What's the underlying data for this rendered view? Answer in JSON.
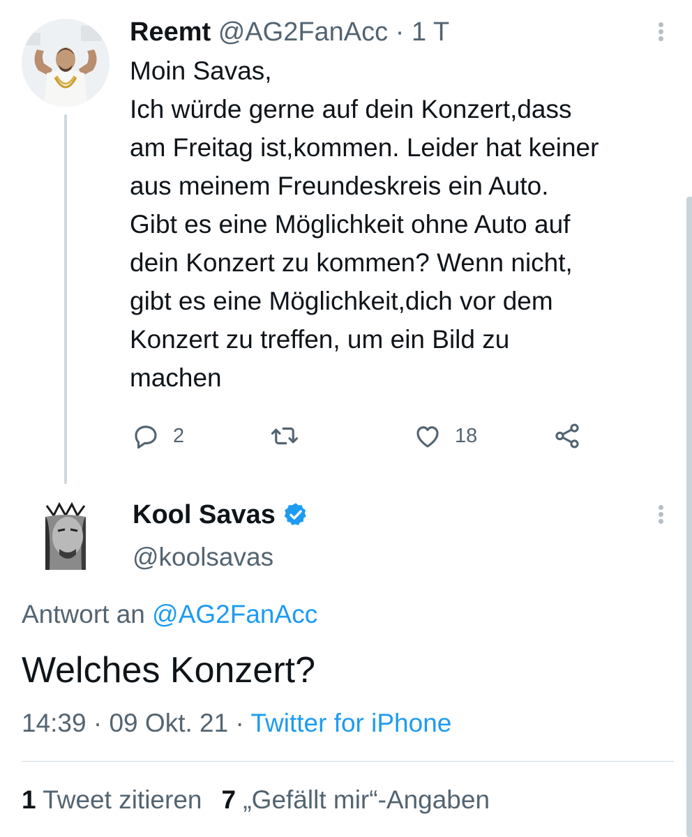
{
  "parent_tweet": {
    "author_name": "Reemt",
    "author_handle": "@AG2FanAcc",
    "separator": "·",
    "time_ago": "1 T",
    "text_lines": [
      "Moin Savas,",
      "Ich würde gerne auf dein Konzert,dass",
      "am Freitag ist,kommen. Leider hat keiner",
      "aus meinem Freundeskreis ein Auto.",
      "Gibt es eine Möglichkeit ohne Auto auf",
      "dein Konzert zu kommen? Wenn nicht,",
      "gibt es eine Möglichkeit,dich vor dem",
      "Konzert zu treffen, um ein Bild zu",
      "machen"
    ],
    "reply_count": "2",
    "retweet_count": "",
    "like_count": "18",
    "icons": [
      "reply-icon",
      "retweet-icon",
      "like-icon",
      "share-icon",
      "more-icon"
    ]
  },
  "main_tweet": {
    "author_name": "Kool Savas",
    "author_handle": "@koolsavas",
    "verified": true,
    "reply_prefix": "Antwort an ",
    "reply_target": "@AG2FanAcc",
    "text": "Welches Konzert?",
    "time": "14:39",
    "date": "09 Okt. 21",
    "separator": "·",
    "source": "Twitter for iPhone",
    "quote_count": "1",
    "quote_label": "Tweet zitieren",
    "like_count": "7",
    "like_label": "„Gefällt mir“-Angaben"
  },
  "colors": {
    "text": "#0f1419",
    "secondary": "#536471",
    "link": "#1d9bf0",
    "divider": "#cfd9de"
  }
}
